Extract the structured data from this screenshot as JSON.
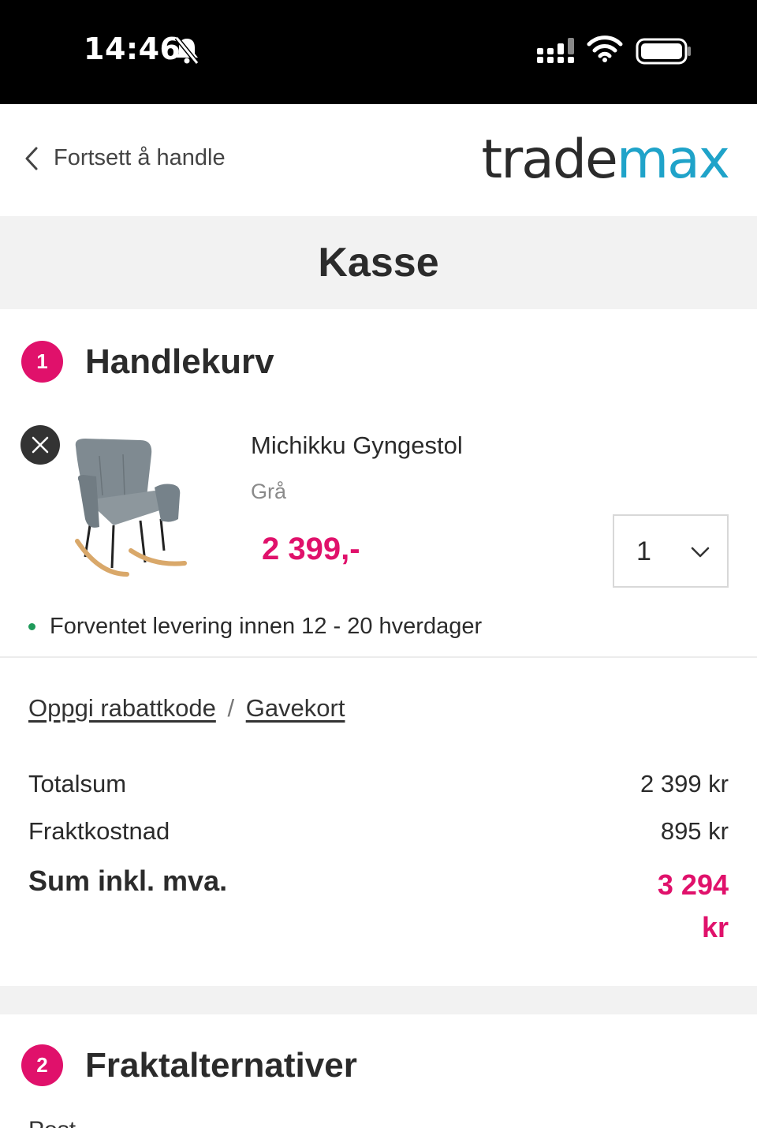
{
  "status_bar": {
    "time": "14:46",
    "icons": [
      "bell-muted-icon",
      "signal-icon",
      "wifi-icon",
      "battery-icon"
    ]
  },
  "header": {
    "back_label": "Fortsett å handle",
    "logo_part1": "trade",
    "logo_part2": "max"
  },
  "page": {
    "title": "Kasse"
  },
  "cart_section": {
    "step": "1",
    "heading": "Handlekurv",
    "item": {
      "name": "Michikku Gyngestol",
      "variant": "Grå",
      "price": "2 399,-",
      "quantity": "1"
    },
    "delivery_note": "Forventet levering innen 12 - 20 hverdager"
  },
  "discount": {
    "code_link": "Oppgi rabattkode",
    "separator": "/",
    "giftcard_link": "Gavekort"
  },
  "totals": {
    "subtotal_label": "Totalsum",
    "subtotal_value": "2 399 kr",
    "shipping_label": "Fraktkostnad",
    "shipping_value": "895 kr",
    "sum_label": "Sum inkl. mva.",
    "sum_value": "3 294 kr"
  },
  "shipping_section": {
    "step": "2",
    "heading": "Fraktalternativer",
    "partial_text": "Post"
  },
  "colors": {
    "accent": "#e0116b",
    "logo_max": "#1fa3c9",
    "delivery_dot": "#1f9a5a"
  }
}
